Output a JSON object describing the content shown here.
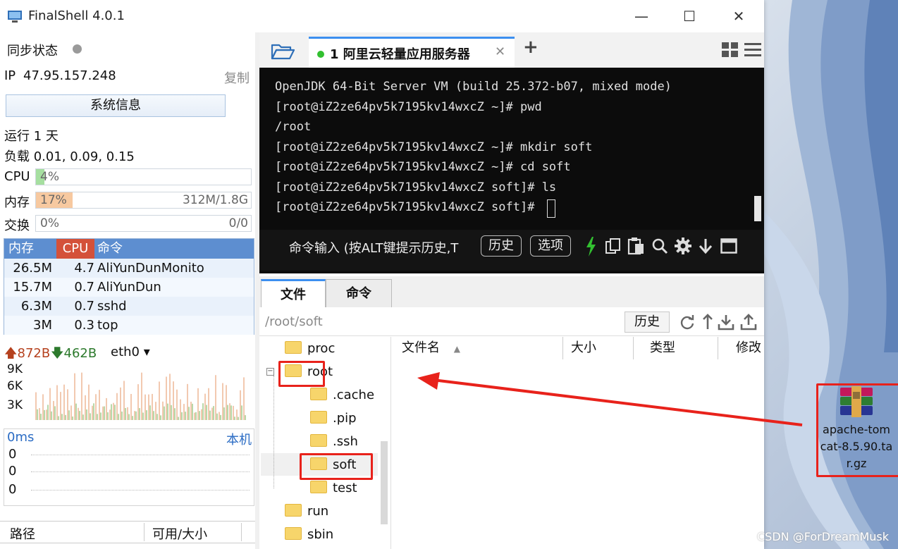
{
  "window": {
    "title": "FinalShell 4.0.1",
    "minimize": "—",
    "maximize": "☐",
    "close": "✕"
  },
  "left": {
    "sync_label": "同步状态",
    "ip_label": "IP",
    "ip_value": "47.95.157.248",
    "copy_label": "复制",
    "sysinfo_button": "系统信息",
    "uptime": "运行 1 天",
    "load": "负载 0.01, 0.09, 0.15",
    "cpu_label": "CPU",
    "cpu_value": "4%",
    "cpu_fraction": 0.04,
    "mem_label": "内存",
    "mem_value": "17%",
    "mem_total": "312M/1.8G",
    "mem_fraction": 0.17,
    "swap_label": "交换",
    "swap_value": "0%",
    "swap_total": "0/0",
    "proc_headers": [
      "内存",
      "CPU",
      "命令"
    ],
    "processes": [
      {
        "mem": "26.5M",
        "cpu": "4.7",
        "cmd": "AliYunDunMonito"
      },
      {
        "mem": "15.7M",
        "cpu": "0.7",
        "cmd": "AliYunDun"
      },
      {
        "mem": "6.3M",
        "cpu": "0.7",
        "cmd": "sshd"
      },
      {
        "mem": "3M",
        "cpu": "0.3",
        "cmd": "top"
      }
    ],
    "net_up": "872B",
    "net_down": "462B",
    "net_iface": "eth0",
    "net_ticks": [
      "9K",
      "6K",
      "3K"
    ],
    "ping_label": "0ms",
    "ping_target": "本机",
    "ping_ticks": [
      "0",
      "0",
      "0"
    ],
    "path_col": "路径",
    "avail_col": "可用/大小"
  },
  "session": {
    "tab_label": "1 阿里云轻量应用服务器",
    "close": "✕",
    "add": "+"
  },
  "terminal": {
    "lines": [
      "OpenJDK 64-Bit Server VM (build 25.372-b07, mixed mode)",
      "[root@iZ2ze64pv5k7195kv14wxcZ ~]# pwd",
      "/root",
      "[root@iZ2ze64pv5k7195kv14wxcZ ~]# mkdir soft",
      "[root@iZ2ze64pv5k7195kv14wxcZ ~]# cd soft",
      "[root@iZ2ze64pv5k7195kv14wxcZ soft]# ls",
      "[root@iZ2ze64pv5k7195kv14wxcZ soft]# "
    ],
    "cmd_hint": "命令输入 (按ALT键提示历史,T",
    "history_btn": "历史",
    "options_btn": "选项"
  },
  "files": {
    "tab_files": "文件",
    "tab_commands": "命令",
    "current_path": "/root/soft",
    "history_btn": "历史",
    "tree": [
      {
        "name": "proc",
        "level": 0
      },
      {
        "name": "root",
        "level": 0
      },
      {
        "name": ".cache",
        "level": 1
      },
      {
        "name": ".pip",
        "level": 1
      },
      {
        "name": ".ssh",
        "level": 1
      },
      {
        "name": "soft",
        "level": 1
      },
      {
        "name": "test",
        "level": 1
      },
      {
        "name": "run",
        "level": 0
      },
      {
        "name": "sbin",
        "level": 0
      }
    ],
    "columns": [
      "文件名",
      "大小",
      "类型",
      "修改"
    ]
  },
  "desktop": {
    "file_line1": "apache-tom",
    "file_line2": "cat-8.5.90.ta",
    "file_line3": "r.gz",
    "watermark": "CSDN @ForDreamMusk"
  },
  "colors": {
    "accent": "#3c8ff0",
    "annotation": "#e8221b",
    "terminal_bg": "#0c0c0c",
    "cpu_fill": "#a6dfa0",
    "mem_fill": "#f7c9a0",
    "proc_header": "#5d8ed0",
    "cpu_header": "#d4513a",
    "lightning": "#32c030"
  }
}
